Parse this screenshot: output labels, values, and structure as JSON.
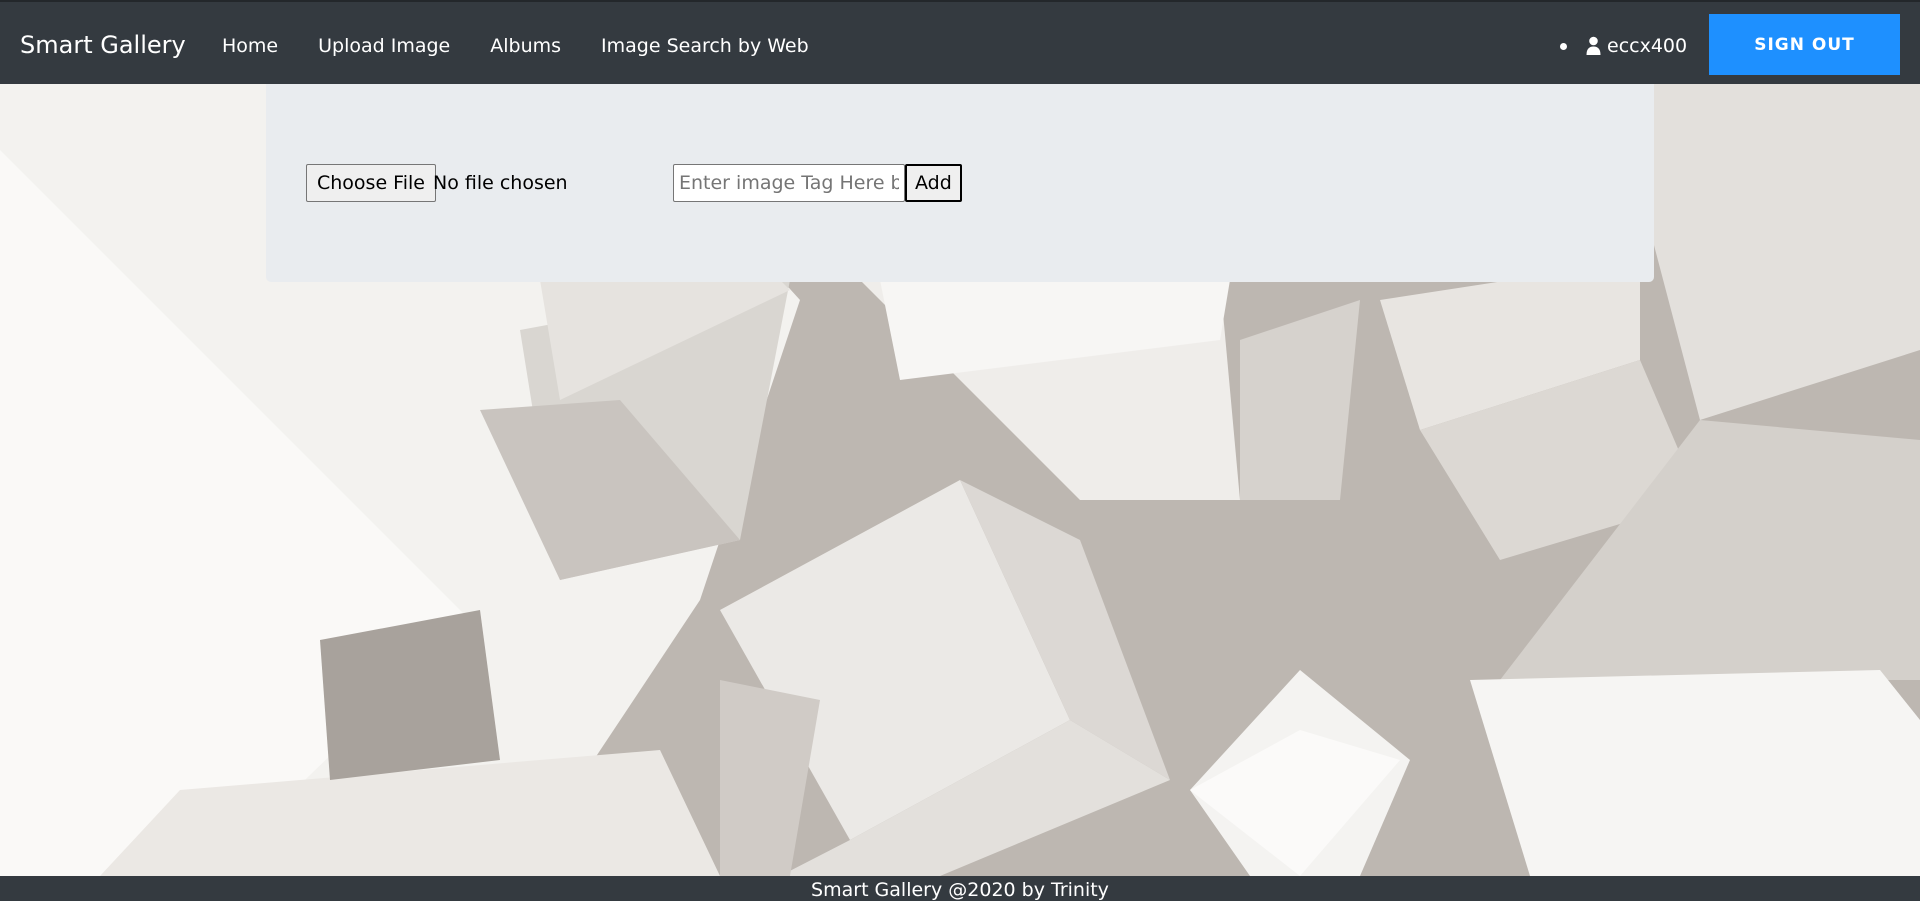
{
  "navbar": {
    "brand": "Smart Gallery",
    "links": [
      {
        "label": "Home"
      },
      {
        "label": "Upload Image"
      },
      {
        "label": "Albums"
      },
      {
        "label": "Image Search by Web"
      }
    ],
    "username": "eccx400",
    "user_icon": "user-icon",
    "signout_label": "SIGN OUT",
    "signout_color": "#1e90ff",
    "background_color": "#343a40"
  },
  "upload": {
    "choose_file_label": "Choose File",
    "file_status": "No file chosen",
    "tag_placeholder": "Enter image Tag Here before upload",
    "tag_value": "",
    "add_label": "Add",
    "panel_color": "#e9ecef"
  },
  "footer": {
    "text": "Smart Gallery @2020 by Trinity"
  }
}
